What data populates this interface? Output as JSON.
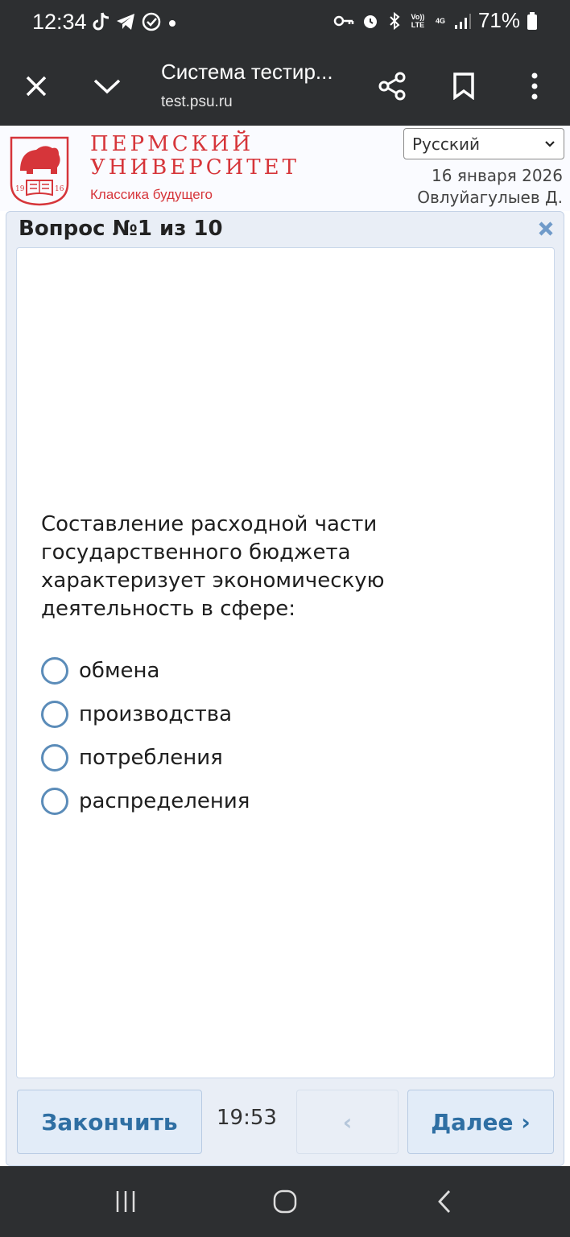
{
  "status_bar": {
    "time": "12:34",
    "battery": "71%",
    "net_volte": "Vo)) LTE",
    "net_4g": "4G"
  },
  "browser": {
    "title": "Система тестир...",
    "url": "test.psu.ru"
  },
  "header": {
    "logo_line1": "ПЕРМСКИЙ",
    "logo_line2": "УНИВЕРСИТЕТ",
    "logo_tagline": "Классика будущего",
    "logo_year_left": "19",
    "logo_year_right": "16",
    "language": "Русский",
    "date": "16 января 2026",
    "user": "Овлуйагулыев Д."
  },
  "question": {
    "title": "Вопрос №1 из 10",
    "text": "Составление расходной части государственного бюджета характеризует экономическую деятельность в сфере:",
    "options": [
      "обмена",
      "производства",
      "потребления",
      "распределения"
    ]
  },
  "controls": {
    "finish_label": "Закончить",
    "timer": "19:53",
    "prev_label": "‹",
    "next_label": "Далее ›"
  },
  "colors": {
    "brand_red": "#d6353a",
    "accent_blue": "#2f6fa3",
    "panel_bg": "#e9eef6",
    "system_bar": "#2d2f31"
  }
}
